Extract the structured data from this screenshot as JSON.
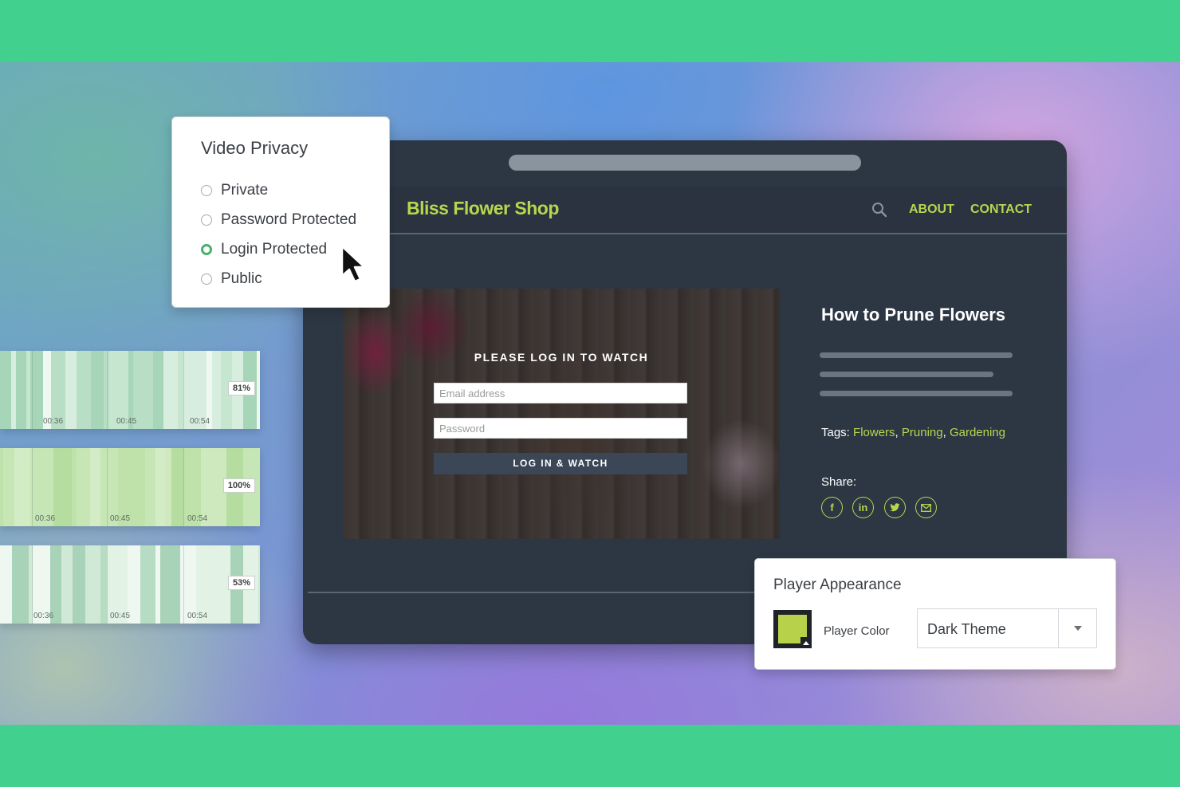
{
  "privacy": {
    "title": "Video Privacy",
    "options": [
      "Private",
      "Password Protected",
      "Login Protected",
      "Public"
    ],
    "selected": "Login Protected"
  },
  "site": {
    "logo": "Bliss Flower Shop",
    "nav": [
      "ABOUT",
      "CONTACT"
    ],
    "icons": [
      "search-icon"
    ]
  },
  "player": {
    "prompt": "PLEASE LOG IN TO WATCH",
    "email_placeholder": "Email address",
    "password_placeholder": "Password",
    "button": "LOG IN & WATCH"
  },
  "article": {
    "title": "How to Prune Flowers",
    "tags_label": "Tags:",
    "tags": [
      "Flowers",
      "Pruning",
      "Gardening"
    ],
    "share_label": "Share:",
    "share_icons": [
      "facebook-icon",
      "linkedin-icon",
      "twitter-icon",
      "email-icon"
    ]
  },
  "heatmaps": [
    {
      "percent": "81%",
      "ticks": [
        "00:36",
        "00:45",
        "00:54"
      ],
      "level": 0.81
    },
    {
      "percent": "100%",
      "ticks": [
        "00:36",
        "00:45",
        "00:54"
      ],
      "level": 1.0
    },
    {
      "percent": "53%",
      "ticks": [
        "00:36",
        "00:45",
        "00:54"
      ],
      "level": 0.53
    }
  ],
  "appearance": {
    "title": "Player Appearance",
    "color_label": "Player Color",
    "theme_value": "Dark Theme",
    "swatch_color": "#b8d14a"
  },
  "colors": {
    "accent": "#b7d64f",
    "band": "#41d08e",
    "selected_radio": "#4caf6d",
    "browser_bg": "#2d3744"
  }
}
